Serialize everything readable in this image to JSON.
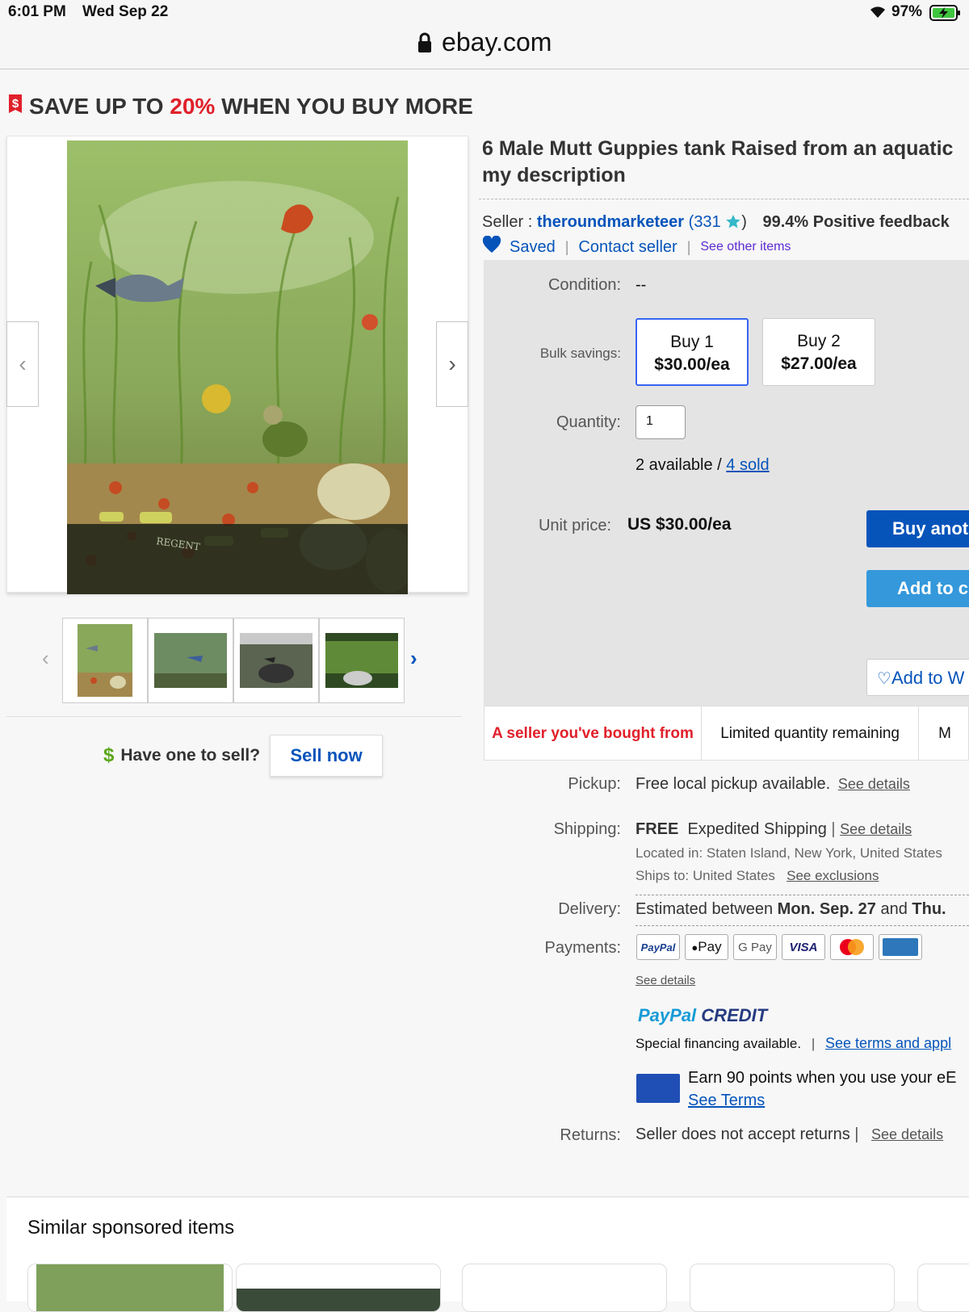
{
  "status_bar": {
    "time": "6:01 PM",
    "date": "Wed Sep 22",
    "battery": "97%"
  },
  "url_bar": {
    "url": "ebay.com"
  },
  "promo": {
    "prefix": "SAVE UP TO ",
    "highlight": "20%",
    "suffix": " WHEN YOU BUY MORE",
    "highlight_color": "#e0202a"
  },
  "gallery": {
    "watermark": "REGENT",
    "thumbnails": [
      "thumbnail 1",
      "thumbnail 2",
      "thumbnail 3",
      "thumbnail 4"
    ]
  },
  "sell": {
    "question": "Have one to sell?",
    "button": "Sell now"
  },
  "listing": {
    "title_line1": "6 Male Mutt Guppies tank Raised from an aquatic",
    "title_line2": "my description"
  },
  "seller": {
    "prefix": "Seller : ",
    "name": "theroundmarketeer",
    "score_open": " (",
    "score": "331",
    "score_close": ")",
    "feedback": "99.4% Positive feedback",
    "saved": "Saved",
    "contact": "Contact seller",
    "other_items": "See other items"
  },
  "purchase": {
    "condition_label": "Condition:",
    "condition_value": "--",
    "bulk_label": "Bulk savings:",
    "bulk_options": [
      {
        "qty": "Buy 1",
        "price": "$30.00/ea"
      },
      {
        "qty": "Buy 2",
        "price": "$27.00/ea"
      }
    ],
    "quantity_label": "Quantity:",
    "quantity_value": "1",
    "available": "2 available / ",
    "sold": "4 sold",
    "unit_price_label": "Unit price:",
    "unit_price": "US $30.00/ea",
    "buy_button": "Buy anot",
    "cart_button": "Add to c",
    "watch_button": "Add to W"
  },
  "badges": {
    "seller_bought": "A seller you've bought from",
    "limited": "Limited quantity remaining",
    "more": "M"
  },
  "details": {
    "pickup_label": "Pickup:",
    "pickup_value": "Free local pickup available.",
    "see_details": "See details",
    "shipping_label": "Shipping:",
    "shipping_free": "FREE",
    "shipping_method": "Expedited Shipping",
    "located": "Located in: Staten Island, New York, United States",
    "ships_to": "Ships to: United States",
    "see_exclusions": "See exclusions",
    "delivery_label": "Delivery:",
    "delivery_prefix": "Estimated between ",
    "delivery_start": "Mon. Sep. 27",
    "delivery_and": " and ",
    "delivery_end": "Thu.",
    "payments_label": "Payments:",
    "payment_methods": [
      "PayPal",
      "Pay",
      "G Pay",
      "VISA",
      "Mastercard",
      "American Express"
    ],
    "payments_see_details": "See details",
    "paypal_credit_a": "PayPal",
    "paypal_credit_b": "CREDIT",
    "financing": "Special financing available.",
    "see_terms_apply": "See terms and appl",
    "earn_points": "Earn 90 points when you use your eE",
    "see_terms": "See Terms",
    "returns_label": "Returns:",
    "returns_value": "Seller does not accept returns",
    "returns_see_details": "See details"
  },
  "similar": {
    "title": "Similar sponsored items"
  },
  "colors": {
    "ebay_blue": "#0654ba",
    "buy_blue": "#0654ba",
    "cart_blue": "#3498db",
    "panel_grey": "#e4e4e4",
    "alert_red": "#e0202a"
  }
}
